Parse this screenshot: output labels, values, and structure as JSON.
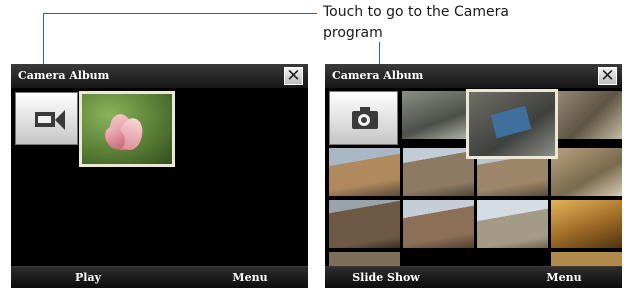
{
  "callout": {
    "line1": "Touch to go to the Camera",
    "line2": "program"
  },
  "left_screen": {
    "title": "Camera Album",
    "close_glyph": "✕",
    "softkeys": {
      "left": "Play",
      "right": "Menu"
    },
    "mode_icon": "video-camera-icon",
    "thumbnail": "lotus-flower-photo"
  },
  "right_screen": {
    "title": "Camera Album",
    "close_glyph": "✕",
    "softkeys": {
      "left": "Slide Show",
      "right": "Menu"
    },
    "mode_icon": "photo-camera-icon"
  },
  "colors": {
    "leader_line": "#2a5db0",
    "screen_background": "#000000",
    "selection_frame": "#ece8d4"
  }
}
